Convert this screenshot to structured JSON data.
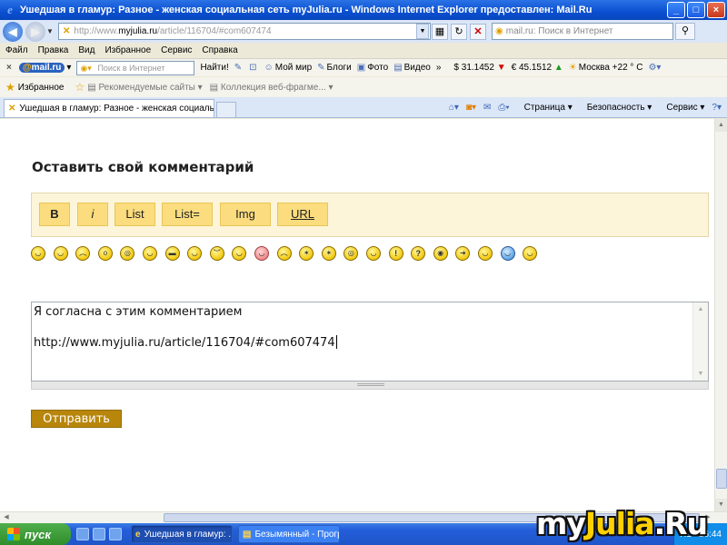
{
  "window": {
    "title": "Ушедшая в гламур: Разное - женская социальная сеть myJulia.ru - Windows Internet Explorer предоставлен: Mail.Ru",
    "buttons": [
      "_",
      "□",
      "×"
    ]
  },
  "address": {
    "prefix": "http://www.",
    "host": "myjulia.ru",
    "path": "/article/116704/#com607474",
    "search_placeholder": "mail.ru: Поиск в Интернет"
  },
  "menu": [
    "Файл",
    "Правка",
    "Вид",
    "Избранное",
    "Сервис",
    "Справка"
  ],
  "mailbar": {
    "logo_at": "@",
    "logo_text": "mail.ru",
    "search_placeholder": "Поиск в Интернет",
    "find_label": "Найти!",
    "links": [
      "Мой мир",
      "Блоги",
      "Фото",
      "Видео"
    ],
    "more": "»",
    "usd": "$ 31.1452",
    "eur": "€ 45.1512",
    "weather": "Москва +22 ° C"
  },
  "favbar": {
    "favorites": "Избранное",
    "recommended": "Рекомендуемые сайты",
    "collection": "Коллекция веб-фрагме..."
  },
  "tabs": {
    "active_title": "Ушедшая в гламур: Разное - женская социальная ...",
    "tools": [
      "Страница",
      "Безопасность",
      "Сервис"
    ]
  },
  "comment_form": {
    "heading": "Оставить свой комментарий",
    "buttons": [
      "B",
      "i",
      "List",
      "List=",
      "Img",
      "URL"
    ],
    "smiley_count": 23,
    "text_line1": "Я согласна с этим комментарием",
    "text_line2": "http://www.myjulia.ru/article/116704/#com607474",
    "submit_label": "Отправить"
  },
  "taskbar": {
    "start_label": "пуск",
    "items": [
      "Ушедшая в гламур: ...",
      "Безымянный - Прогр..."
    ],
    "lang": "RL",
    "clock": "16:44"
  },
  "watermark": {
    "part1": "my",
    "part2": "Julia",
    "part3": ".Ru"
  },
  "colors": {
    "toolbar_bg": "#fdf5d9",
    "format_button": "#fbdc7e",
    "submit_button": "#b8860b",
    "title_bar": "#0a4fd0"
  }
}
